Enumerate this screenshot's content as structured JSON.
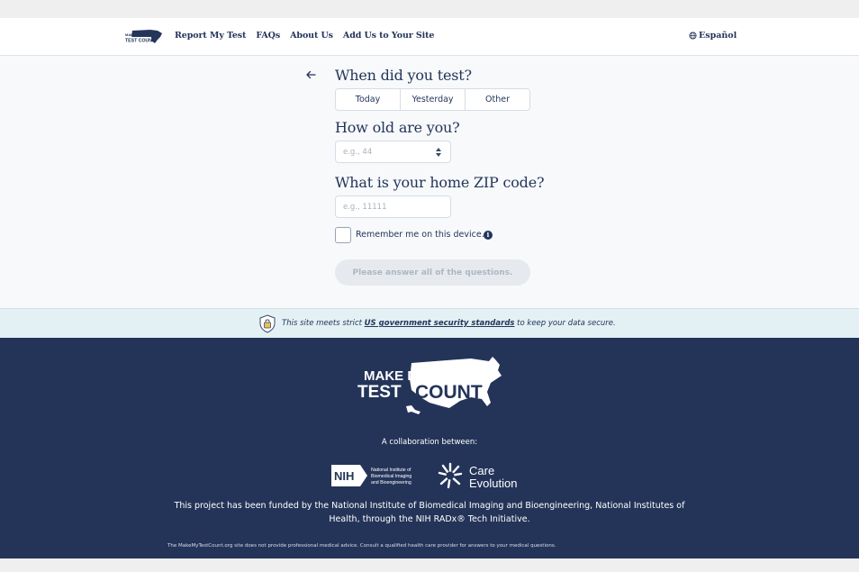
{
  "header": {
    "logo_text_top": "MAKE MY",
    "logo_text_bottom": "TEST COUNT",
    "nav": [
      "Report My Test",
      "FAQs",
      "About Us",
      "Add Us to Your Site"
    ],
    "language": "Español",
    "language_icon": "globe-icon"
  },
  "form": {
    "q1": "When did you test?",
    "q1_options": [
      "Today",
      "Yesterday",
      "Other"
    ],
    "q2": "How old are you?",
    "age_placeholder": "e.g., 44",
    "q3": "What is your home ZIP code?",
    "zip_placeholder": "e.g., 11111",
    "remember_label": "Remember me on this device.",
    "info_glyph": "i",
    "submit_label": "Please answer all of the questions."
  },
  "security": {
    "prefix": "This site meets strict ",
    "link": "US government security standards",
    "suffix": " to keep your data secure."
  },
  "footer": {
    "logo_top": "MAKE MY",
    "logo_left": "TEST",
    "logo_right": "COUNT",
    "collab": "A collaboration between:",
    "nih_badge": "NIH",
    "nih_line1": "National Institute of",
    "nih_line2": "Biomedical Imaging",
    "nih_line3": "and Bioengineering",
    "ce_line1": "Care",
    "ce_line2": "Evolution",
    "funded": "This project has been funded by the National Institute of Biomedical Imaging and Bioengineering, National Institutes of Health, through the NIH RADx® Tech Initiative.",
    "disclaimer": "The MakeMyTestCount.org site does not provide professional medical advice. Consult a qualified health care provider for answers to your medical questions."
  },
  "colors": {
    "navy": "#243459",
    "banner": "#e3f0f4",
    "disabled": "#e6eaef"
  }
}
